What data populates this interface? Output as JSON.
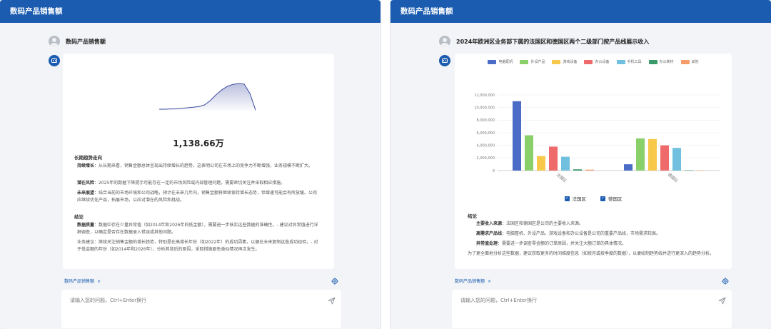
{
  "left": {
    "app_title": "数码产品销售额",
    "question": "数码产品销售额",
    "kpi_value": "1,138.66万",
    "section1_title": "长期趋势走向",
    "items1": [
      {
        "label": "持续增长",
        "text": "：从长期来看，销售金额总体呈现出持续增长的趋势，这表明公司在市场上的竞争力不断增强，业务规模不断扩大。"
      },
      {
        "label": "潜在风险",
        "text": "：2025年的数据下降提示可能存在一定的市场风险或内部管理问题，需要密切关注并采取相应措施。"
      },
      {
        "label": "未来展望",
        "text": "：结合当前的市场环境和公司战略，预计在未来几年内，销售金额将继续保持增长态势，但增速可能会有所放缓。公司应继续优化产品，拓展市场，以应对潜在的风险和挑战。"
      }
    ],
    "section2_title": "结论",
    "items2": [
      {
        "label": "数据质量",
        "text": "：数据中存在少量异常值（如2014年和2026年的低金额），需要进一步核实这些数据的准确性。- 建议对异常值进行详细调查，以确定是否存在数据录入错误或其他问题。"
      },
      {
        "label": "",
        "text": "业务建议：继续关注销售金额的增长趋势，特别是在高增长年份（如2022年）的成功因素，以便在未来复制这些成功经验。- 对于低金额的年份（如2014年和2026年），分析其背后的原因，采取措施避免类似情况再次发生。"
      }
    ],
    "tag_label": "数码产品销售额",
    "tag_close": "×",
    "input_placeholder": "请输入您的问题，Ctrl+Enter换行",
    "sparkline": [
      0.05,
      0.05,
      0.06,
      0.06,
      0.08,
      0.1,
      0.12,
      0.14,
      0.2,
      0.35,
      0.55,
      0.72,
      0.85,
      0.92,
      0.95,
      0.93,
      0.6,
      0.02
    ],
    "sparkline_color": "#3b4aa0"
  },
  "right": {
    "app_title": "数码产品销售额",
    "question": "2024年欧洲区业务部下属的法国区和德国区两个二级部门按产品线展示收入",
    "chart_data": {
      "type": "bar",
      "categories": [
        "法国区",
        "德国区"
      ],
      "series": [
        {
          "name": "电脑配机",
          "color": "#4a6cc7",
          "values": [
            11000000,
            1000000
          ]
        },
        {
          "name": "外设产品",
          "color": "#8ad06a",
          "values": [
            5600000,
            5100000
          ]
        },
        {
          "name": "游戏设备",
          "color": "#f7c84a",
          "values": [
            2300000,
            5000000
          ]
        },
        {
          "name": "办公设备",
          "color": "#ef6b6b",
          "values": [
            3800000,
            4000000
          ]
        },
        {
          "name": "手机工具",
          "color": "#72c0e0",
          "values": [
            2200000,
            3600000
          ]
        },
        {
          "name": "办公耗材",
          "color": "#3a9a6a",
          "values": [
            200000,
            60000
          ]
        },
        {
          "name": "其他",
          "color": "#f59c6a",
          "values": [
            150000,
            40000
          ]
        }
      ],
      "yticks": [
        "0",
        "2,000,000",
        "4,000,000",
        "6,000,000",
        "8,000,000",
        "10,000,000",
        "12,000,000"
      ],
      "ylim": [
        0,
        12000000
      ],
      "legend_position": "top",
      "grid": true
    },
    "region_legend": [
      "法国区",
      "德国区"
    ],
    "conclusion_title": "结论",
    "items": [
      {
        "label": "主要收入来源",
        "text": "：法国区和德国区是公司的主要收入来源。"
      },
      {
        "label": "高需求产品线",
        "text": "：电脑整机、外设产品、游戏设备和办公设备是公司的重要产品线，市场需求较高。"
      },
      {
        "label": "异常值处理",
        "text": "：需要进一步调查零金额的订单原因，并关注大额订单的具体情况。"
      }
    ],
    "footer_note": "为了更全面地分析这些数据，建议获取更多的时间维度信息（如按月或按季度的数据），以便绘制趋势线并进行更深入的趋势分析。",
    "tag_label": "数码产品销售额",
    "tag_close": "×",
    "input_placeholder": "请输入您的问题，Ctrl+Enter换行"
  }
}
